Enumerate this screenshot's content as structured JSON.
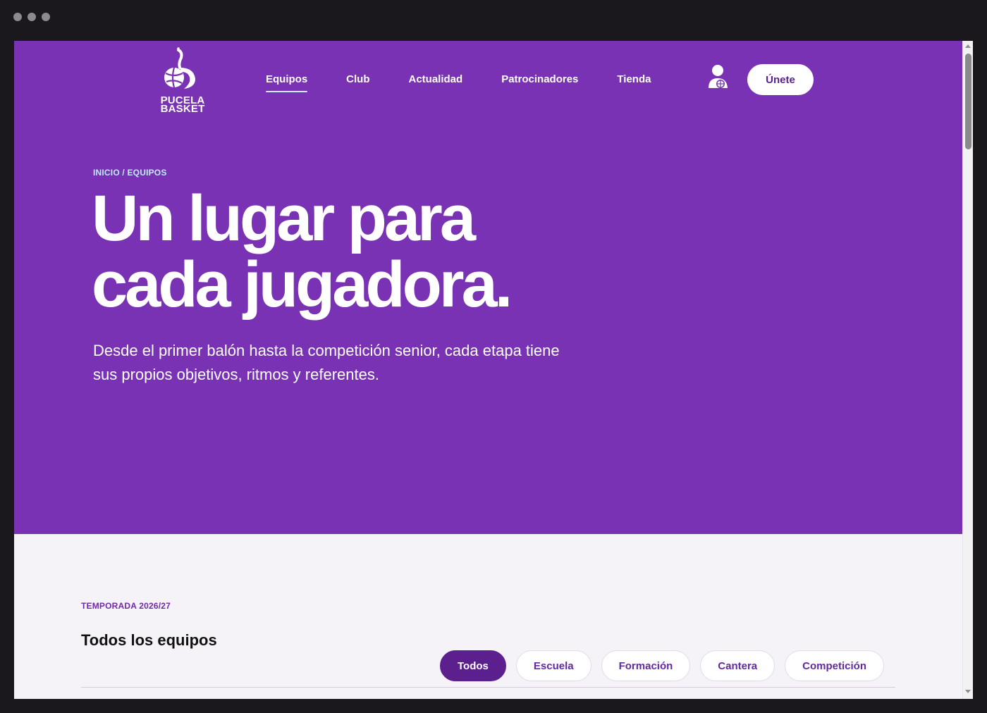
{
  "brand": {
    "logo_line1": "PUCELA",
    "logo_line2": "BASKET",
    "hero_color": "#7932b3"
  },
  "nav": {
    "items": [
      {
        "label": "Equipos",
        "active": true
      },
      {
        "label": "Club",
        "active": false
      },
      {
        "label": "Actualidad",
        "active": false
      },
      {
        "label": "Patrocinadores",
        "active": false
      },
      {
        "label": "Tienda",
        "active": false
      }
    ],
    "user_icon": "user-basketball-icon",
    "join_label": "Únete"
  },
  "hero": {
    "breadcrumb": "INICIO / EQUIPOS",
    "title_line1": "Un lugar para",
    "title_line2": "cada jugadora.",
    "subtitle": "Desde el primer balón hasta la competición senior, cada etapa tiene sus propios objetivos, ritmos y referentes."
  },
  "teams": {
    "season_label": "TEMPORADA 2026/27",
    "title": "Todos los equipos",
    "filters": [
      {
        "label": "Todos",
        "active": true
      },
      {
        "label": "Escuela",
        "active": false
      },
      {
        "label": "Formación",
        "active": false
      },
      {
        "label": "Cantera",
        "active": false
      },
      {
        "label": "Competición",
        "active": false
      }
    ]
  }
}
